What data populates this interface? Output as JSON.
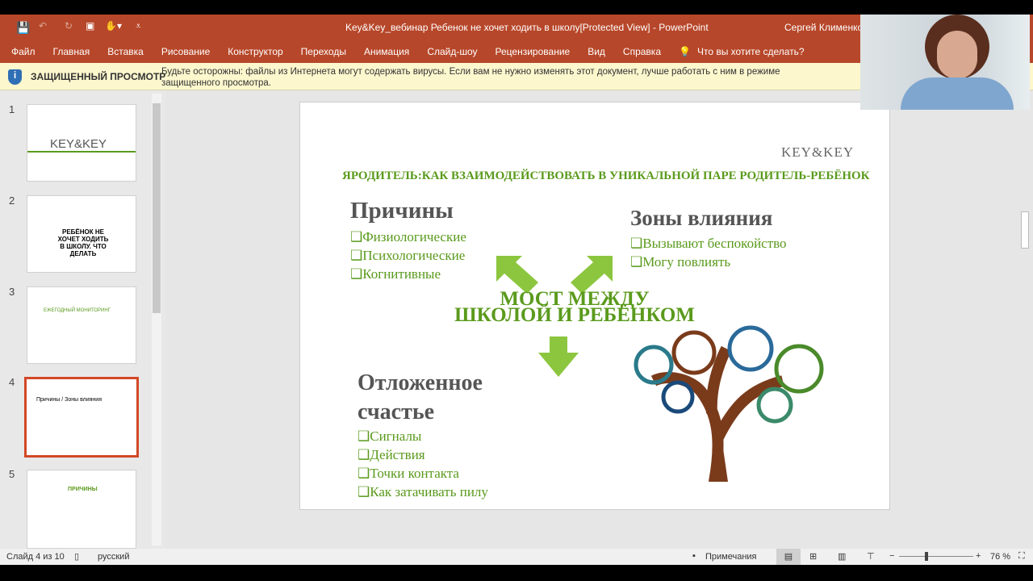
{
  "titlebar": {
    "title": "Key&Key_вебинар Ребенок не хочет ходить в школу[Protected View]  -  PowerPoint",
    "user": "Сергей Клименко"
  },
  "ribbon": {
    "tabs": [
      "Файл",
      "Главная",
      "Вставка",
      "Рисование",
      "Конструктор",
      "Переходы",
      "Анимация",
      "Слайд-шоу",
      "Рецензирование",
      "Вид",
      "Справка"
    ],
    "tell_me": "Что вы хотите сделать?"
  },
  "protected": {
    "label": "ЗАЩИЩЕННЫЙ ПРОСМОТР",
    "message": "Будьте осторожны: файлы из Интернета могут содержать вирусы. Если вам не нужно изменять этот документ, лучше работать с ним в режиме защищенного просмотра."
  },
  "thumbnails": [
    {
      "num": "1",
      "text": "KEY&KEY"
    },
    {
      "num": "2",
      "text": "РЕБЁНОК НЕ ХОЧЕТ ХОДИТЬ В ШКОЛУ. ЧТО ДЕЛАТЬ"
    },
    {
      "num": "3",
      "text": "ЕЖЕГОДНЫЙ МОНИТОРИНГ"
    },
    {
      "num": "4",
      "text": "Причины / Зоны влияния"
    },
    {
      "num": "5",
      "text": "ПРИЧИНЫ"
    }
  ],
  "slide": {
    "logo": "KEY&KEY",
    "header": "ЯРОДИТЕЛЬ:КАК ВЗАИМОДЕЙСТВОВАТЬ В УНИКАЛЬНОЙ ПАРЕ РОДИТЕЛЬ-РЕБЁНОК",
    "causes_title": "Причины",
    "causes": [
      "❑Физиологические",
      "❑Психологические",
      "❑Когнитивные"
    ],
    "zones_title": "Зоны влияния",
    "zones": [
      "❑Вызывают беспокойство",
      "❑Могу повлиять"
    ],
    "bridge_line1": "МОСТ МЕЖДУ",
    "bridge_line2": "ШКОЛОЙ И РЕБЁНКОМ",
    "delayed_title_1": "Отложенное",
    "delayed_title_2": "счастье",
    "delayed": [
      "❑Сигналы",
      "❑Действия",
      "❑Точки контакта",
      "❑Как затачивать пилу"
    ]
  },
  "status": {
    "slide": "Слайд 4 из 10",
    "lang": "русский",
    "notes": "Примечания",
    "zoom": "76 %"
  },
  "colors": {
    "accent": "#b7472a",
    "green": "#5a9a1c"
  }
}
